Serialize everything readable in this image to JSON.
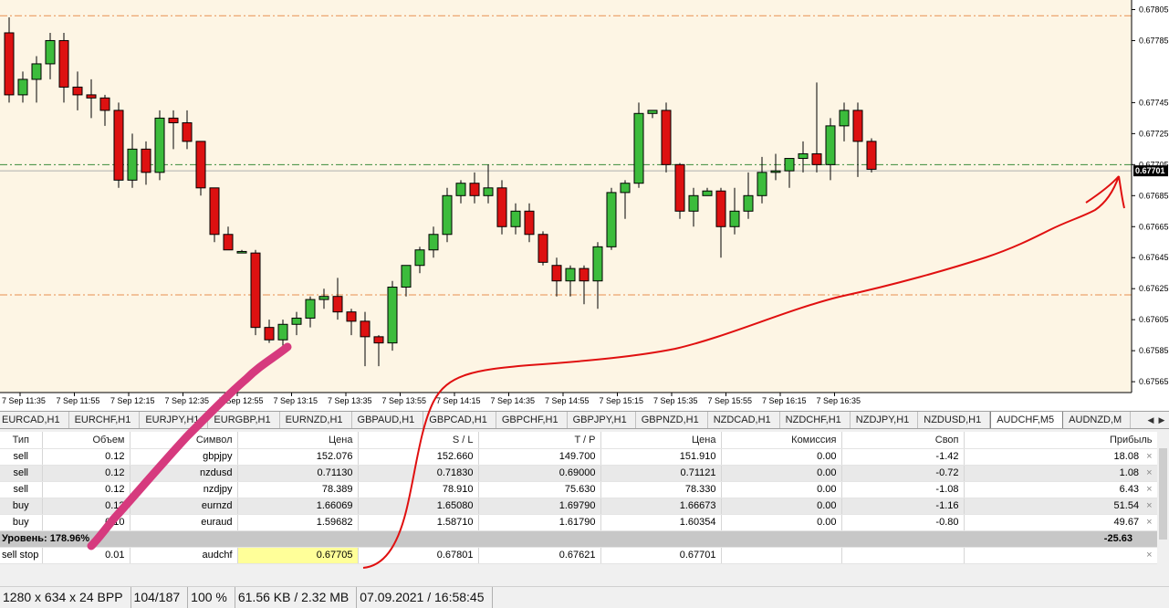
{
  "chart": {
    "bg_color": "#fdf5e4",
    "bull_color": "#3cbc3c",
    "bear_color": "#dd1111",
    "price_levels": [
      "0.67805",
      "0.67785",
      "0.67745",
      "0.67725",
      "0.67705",
      "0.67685",
      "0.67665",
      "0.67645",
      "0.67625",
      "0.67605",
      "0.67585",
      "0.67565"
    ],
    "current_price": "0.67701",
    "time_labels": [
      "7 Sep 11:35",
      "7 Sep 11:55",
      "7 Sep 12:15",
      "7 Sep 12:35",
      "7 Sep 12:55",
      "7 Sep 13:15",
      "7 Sep 13:35",
      "7 Sep 13:55",
      "7 Sep 14:15",
      "7 Sep 14:35",
      "7 Sep 14:55",
      "7 Sep 15:15",
      "7 Sep 15:35",
      "7 Sep 15:55",
      "7 Sep 16:15",
      "7 Sep 16:35"
    ],
    "lines": {
      "tp_orange": 0.67621,
      "sl_orange": 0.67801,
      "green_pending": 0.67705
    },
    "candles": [
      [
        0.6779,
        0.678,
        0.67745,
        0.6775
      ],
      [
        0.6775,
        0.67765,
        0.67745,
        0.6776
      ],
      [
        0.6776,
        0.67775,
        0.67745,
        0.6777
      ],
      [
        0.6777,
        0.6779,
        0.6776,
        0.67785
      ],
      [
        0.67785,
        0.6779,
        0.67745,
        0.67755
      ],
      [
        0.67755,
        0.67765,
        0.6774,
        0.6775
      ],
      [
        0.6775,
        0.6776,
        0.67735,
        0.67748
      ],
      [
        0.67748,
        0.6775,
        0.6773,
        0.6774
      ],
      [
        0.6774,
        0.67745,
        0.6769,
        0.67695
      ],
      [
        0.67695,
        0.67725,
        0.6769,
        0.67715
      ],
      [
        0.67715,
        0.6772,
        0.67692,
        0.677
      ],
      [
        0.677,
        0.6774,
        0.67695,
        0.67735
      ],
      [
        0.67735,
        0.6774,
        0.67715,
        0.67732
      ],
      [
        0.67732,
        0.6774,
        0.67715,
        0.6772
      ],
      [
        0.6772,
        0.6772,
        0.67685,
        0.6769
      ],
      [
        0.6769,
        0.6769,
        0.67655,
        0.6766
      ],
      [
        0.6766,
        0.67665,
        0.6765,
        0.6765
      ],
      [
        0.67648,
        0.6765,
        0.67648,
        0.67649
      ],
      [
        0.67648,
        0.6765,
        0.67595,
        0.676
      ],
      [
        0.676,
        0.67605,
        0.6759,
        0.67592
      ],
      [
        0.67592,
        0.67605,
        0.67585,
        0.67602
      ],
      [
        0.67602,
        0.6761,
        0.67595,
        0.67606
      ],
      [
        0.67606,
        0.6762,
        0.676,
        0.67618
      ],
      [
        0.67618,
        0.67625,
        0.67612,
        0.6762
      ],
      [
        0.6762,
        0.67632,
        0.67605,
        0.6761
      ],
      [
        0.6761,
        0.67612,
        0.67595,
        0.67604
      ],
      [
        0.67604,
        0.6761,
        0.67575,
        0.67594
      ],
      [
        0.67594,
        0.67595,
        0.67575,
        0.6759
      ],
      [
        0.6759,
        0.6763,
        0.67585,
        0.67626
      ],
      [
        0.67626,
        0.6764,
        0.6762,
        0.6764
      ],
      [
        0.6764,
        0.67652,
        0.67635,
        0.6765
      ],
      [
        0.6765,
        0.67665,
        0.67645,
        0.6766
      ],
      [
        0.6766,
        0.6769,
        0.67655,
        0.67685
      ],
      [
        0.67685,
        0.67695,
        0.6768,
        0.67693
      ],
      [
        0.67693,
        0.677,
        0.6768,
        0.67685
      ],
      [
        0.67685,
        0.67705,
        0.6768,
        0.6769
      ],
      [
        0.6769,
        0.67695,
        0.6766,
        0.67665
      ],
      [
        0.67665,
        0.6768,
        0.6766,
        0.67675
      ],
      [
        0.67675,
        0.6768,
        0.67655,
        0.6766
      ],
      [
        0.6766,
        0.67662,
        0.6764,
        0.67642
      ],
      [
        0.6764,
        0.67645,
        0.6762,
        0.6763
      ],
      [
        0.6763,
        0.6764,
        0.6762,
        0.67638
      ],
      [
        0.67638,
        0.6764,
        0.67615,
        0.6763
      ],
      [
        0.6763,
        0.67655,
        0.67612,
        0.67652
      ],
      [
        0.67652,
        0.6769,
        0.6765,
        0.67687
      ],
      [
        0.67687,
        0.67695,
        0.6767,
        0.67693
      ],
      [
        0.67693,
        0.67745,
        0.6769,
        0.67738
      ],
      [
        0.67738,
        0.6774,
        0.67735,
        0.6774
      ],
      [
        0.6774,
        0.67745,
        0.677,
        0.67705
      ],
      [
        0.67705,
        0.67706,
        0.6767,
        0.67675
      ],
      [
        0.67675,
        0.6769,
        0.67665,
        0.67685
      ],
      [
        0.67685,
        0.6769,
        0.67685,
        0.67688
      ],
      [
        0.67688,
        0.6769,
        0.67645,
        0.67665
      ],
      [
        0.67665,
        0.6769,
        0.6766,
        0.67675
      ],
      [
        0.67675,
        0.677,
        0.6767,
        0.67685
      ],
      [
        0.67685,
        0.6771,
        0.6768,
        0.677
      ],
      [
        0.677,
        0.67712,
        0.67695,
        0.67701
      ],
      [
        0.67701,
        0.67705,
        0.6769,
        0.67709
      ],
      [
        0.67709,
        0.6772,
        0.677,
        0.67712
      ],
      [
        0.67712,
        0.67758,
        0.677,
        0.67705
      ],
      [
        0.67705,
        0.67735,
        0.67695,
        0.6773
      ],
      [
        0.6773,
        0.67745,
        0.6772,
        0.6774
      ],
      [
        0.6774,
        0.67745,
        0.67697,
        0.6772
      ],
      [
        0.6772,
        0.67722,
        0.677,
        0.67702
      ]
    ]
  },
  "tabs": [
    "EURCAD,H1",
    "EURCHF,H1",
    "EURJPY,H1",
    "EURGBP,H1",
    "EURNZD,H1",
    "GBPAUD,H1",
    "GBPCAD,H1",
    "GBPCHF,H1",
    "GBPJPY,H1",
    "GBPNZD,H1",
    "NZDCAD,H1",
    "NZDCHF,H1",
    "NZDJPY,H1",
    "NZDUSD,H1",
    "AUDCHF,M5",
    "AUDNZD,M"
  ],
  "active_tab_index": 14,
  "table": {
    "headers": [
      "Тип",
      "Объем",
      "Символ",
      "Цена",
      "S / L",
      "T / P",
      "Цена",
      "Комиссия",
      "Своп",
      "Прибыль"
    ],
    "rows": [
      [
        "sell",
        "0.12",
        "gbpjpy",
        "152.076",
        "152.660",
        "149.700",
        "151.910",
        "0.00",
        "-1.42",
        "18.08"
      ],
      [
        "sell",
        "0.12",
        "nzdusd",
        "0.71130",
        "0.71830",
        "0.69000",
        "0.71121",
        "0.00",
        "-0.72",
        "1.08"
      ],
      [
        "sell",
        "0.12",
        "nzdjpy",
        "78.389",
        "78.910",
        "75.630",
        "78.330",
        "0.00",
        "-1.08",
        "6.43"
      ],
      [
        "buy",
        "0.12",
        "eurnzd",
        "1.66069",
        "1.65080",
        "1.69790",
        "1.66673",
        "0.00",
        "-1.16",
        "51.54"
      ],
      [
        "buy",
        "0.10",
        "euraud",
        "1.59682",
        "1.58710",
        "1.61790",
        "1.60354",
        "0.00",
        "-0.80",
        "49.67"
      ]
    ],
    "level_label": "Уровень: 178.96%",
    "level_total": "-25.63",
    "pending": [
      "sell stop",
      "0.01",
      "audchf",
      "0.67705",
      "0.67801",
      "0.67621",
      "0.67701",
      "",
      ""
    ]
  },
  "status": {
    "dimensions": "1280 x 634 x 24 BPP",
    "index": "104/187",
    "zoom": "100 %",
    "size": "61.56 KB / 2.32 MB",
    "datetime": "07.09.2021 / 16:58:45"
  },
  "close_icon": "close-x-icon"
}
